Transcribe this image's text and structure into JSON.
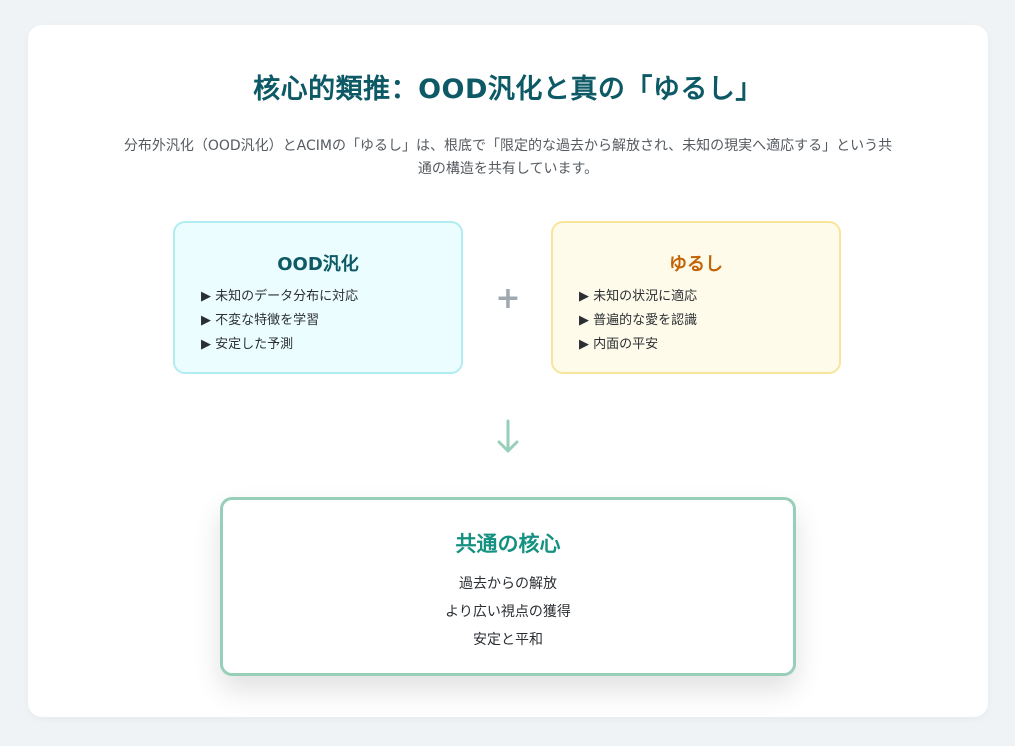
{
  "title": "核心的類推：OOD汎化と真の「ゆるし」",
  "description": "分布外汎化（OOD汎化）とACIMの「ゆるし」は、根底で「限定的な過去から解放され、未知の現実へ適応する」という共通の構造を共有しています。",
  "ood_box": {
    "title": "OOD汎化",
    "items": [
      "▶ 未知のデータ分布に対応",
      "▶ 不変な特徴を学習",
      "▶ 安定した予測"
    ]
  },
  "yurushi_box": {
    "title": "ゆるし",
    "items": [
      "▶ 未知の状況に適応",
      "▶ 普遍的な愛を認識",
      "▶ 内面の平安"
    ]
  },
  "operator": "+",
  "core_box": {
    "title": "共通の核心",
    "items": [
      "過去からの解放",
      "より広い視点の獲得",
      "安定と平和"
    ]
  },
  "colors": {
    "title": "#0d5a66",
    "ood_bg": "#ebfdfe",
    "ood_border": "#b2ecf3",
    "yurushi_bg": "#fffbeb",
    "yurushi_border": "#f8e49a",
    "yurushi_title": "#c26509",
    "core_border": "#97cfb8",
    "core_title": "#159182",
    "arrow": "#97cfb8"
  },
  "icons": {
    "arrow": "arrow-down-icon",
    "plus": "plus-icon"
  }
}
